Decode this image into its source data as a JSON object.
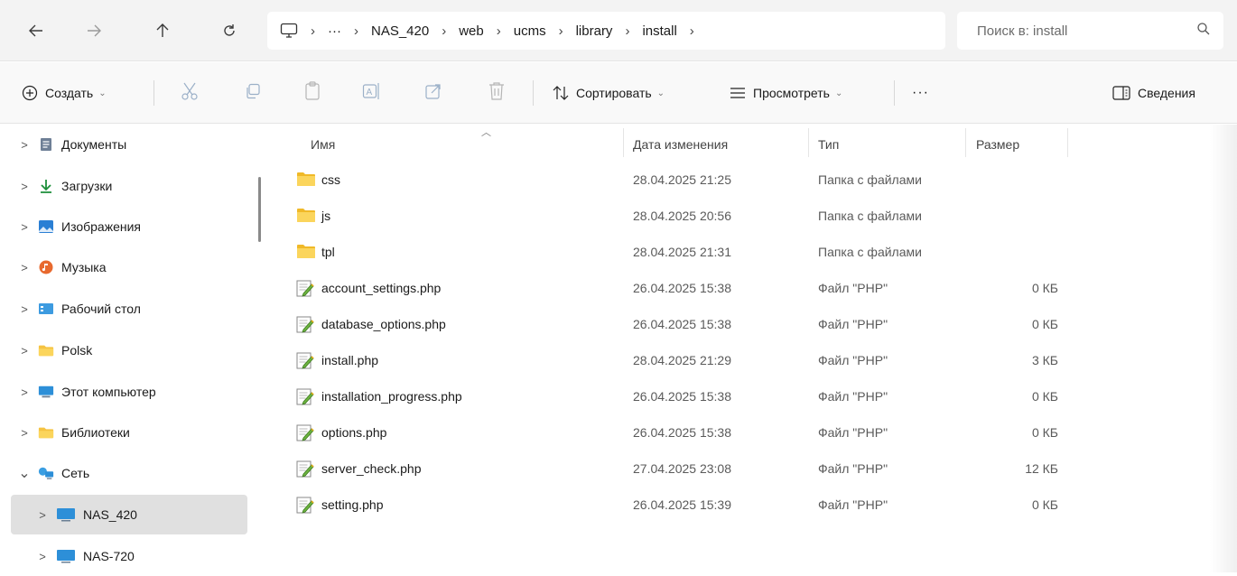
{
  "nav": {
    "back": "back-icon",
    "forward": "forward-icon",
    "up": "up-icon",
    "refresh": "refresh-icon"
  },
  "address": {
    "overflow": "···",
    "crumbs": [
      "NAS_420",
      "web",
      "ucms",
      "library",
      "install"
    ]
  },
  "search": {
    "placeholder": "Поиск в: install"
  },
  "toolbar": {
    "create_label": "Создать",
    "sort_label": "Сортировать",
    "view_label": "Просмотреть",
    "more_label": "···",
    "details_label": "Сведения"
  },
  "sidebar": {
    "items": [
      {
        "label": "Документы",
        "icon": "documents-icon",
        "chev": ">"
      },
      {
        "label": "Загрузки",
        "icon": "downloads-icon",
        "chev": ">"
      },
      {
        "label": "Изображения",
        "icon": "pictures-icon",
        "chev": ">"
      },
      {
        "label": "Музыка",
        "icon": "music-icon",
        "chev": ">"
      },
      {
        "label": "Рабочий стол",
        "icon": "desktop-icon",
        "chev": ">"
      },
      {
        "label": "Polsk",
        "icon": "folder-icon",
        "chev": ">"
      },
      {
        "label": "Этот компьютер",
        "icon": "computer-icon",
        "chev": ">"
      },
      {
        "label": "Библиотеки",
        "icon": "folder-icon",
        "chev": ">"
      },
      {
        "label": "Сеть",
        "icon": "network-icon",
        "chev": "⌄"
      },
      {
        "label": "NAS_420",
        "icon": "computer-icon",
        "chev": ">"
      },
      {
        "label": "NAS-720",
        "icon": "computer-icon",
        "chev": ">"
      }
    ]
  },
  "columns": {
    "name": "Имя",
    "modified": "Дата изменения",
    "type": "Тип",
    "size": "Размер"
  },
  "files": [
    {
      "name": "css",
      "modified": "28.04.2025 21:25",
      "type": "Папка с файлами",
      "size": "",
      "kind": "folder"
    },
    {
      "name": "js",
      "modified": "28.04.2025 20:56",
      "type": "Папка с файлами",
      "size": "",
      "kind": "folder"
    },
    {
      "name": "tpl",
      "modified": "28.04.2025 21:31",
      "type": "Папка с файлами",
      "size": "",
      "kind": "folder"
    },
    {
      "name": "account_settings.php",
      "modified": "26.04.2025 15:38",
      "type": "Файл \"PHP\"",
      "size": "0 КБ",
      "kind": "php"
    },
    {
      "name": "database_options.php",
      "modified": "26.04.2025 15:38",
      "type": "Файл \"PHP\"",
      "size": "0 КБ",
      "kind": "php"
    },
    {
      "name": "install.php",
      "modified": "28.04.2025 21:29",
      "type": "Файл \"PHP\"",
      "size": "3 КБ",
      "kind": "php"
    },
    {
      "name": "installation_progress.php",
      "modified": "26.04.2025 15:38",
      "type": "Файл \"PHP\"",
      "size": "0 КБ",
      "kind": "php"
    },
    {
      "name": "options.php",
      "modified": "26.04.2025 15:38",
      "type": "Файл \"PHP\"",
      "size": "0 КБ",
      "kind": "php"
    },
    {
      "name": "server_check.php",
      "modified": "27.04.2025 23:08",
      "type": "Файл \"PHP\"",
      "size": "12 КБ",
      "kind": "php"
    },
    {
      "name": "setting.php",
      "modified": "26.04.2025 15:39",
      "type": "Файл \"PHP\"",
      "size": "0 КБ",
      "kind": "php"
    }
  ]
}
